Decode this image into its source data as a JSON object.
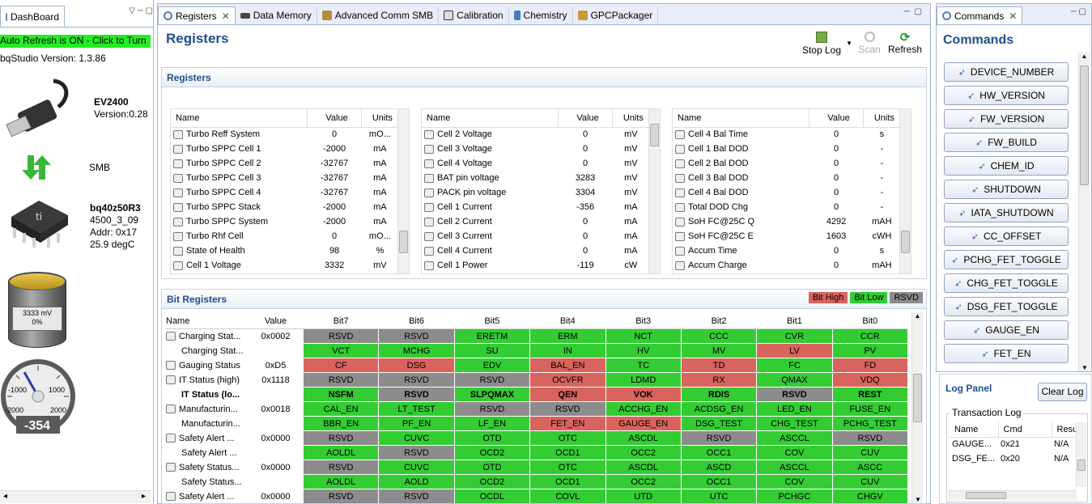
{
  "dashboard": {
    "tab_label": "DashBoard",
    "auto_refresh": "Auto Refresh is ON - Click to Turn",
    "version_line": "bqStudio Version:  1.3.86",
    "ev_name": "EV2400",
    "ev_version": "Version:0.28",
    "bus": "SMB",
    "device_name": "bq40z50R3",
    "device_fw": "4500_3_09",
    "device_addr": "Addr: 0x17",
    "device_temp": "25.9 degC",
    "battery_voltage": "3333 mV",
    "battery_pct": "0%",
    "gauge_value": "-354",
    "gauge_ticks": [
      "-1000",
      "1000",
      "-2000",
      "2000"
    ]
  },
  "tabs": [
    {
      "label": "Registers",
      "icon": "gear-icon"
    },
    {
      "label": "Data Memory",
      "icon": "memory-icon"
    },
    {
      "label": "Advanced Comm SMB",
      "icon": "package-icon"
    },
    {
      "label": "Calibration",
      "icon": "calibration-icon"
    },
    {
      "label": "Chemistry",
      "icon": "flask-icon"
    },
    {
      "label": "GPCPackager",
      "icon": "packager-icon"
    }
  ],
  "registers_page": {
    "title": "Registers",
    "stop_log": "Stop Log",
    "scan": "Scan",
    "refresh": "Refresh",
    "section": "Registers",
    "headers": [
      "Name",
      "Value",
      "Units"
    ],
    "table1": [
      [
        "Turbo Reff System",
        "0",
        "mO..."
      ],
      [
        "Turbo SPPC Cell 1",
        "-2000",
        "mA"
      ],
      [
        "Turbo SPPC Cell 2",
        "-32767",
        "mA"
      ],
      [
        "Turbo SPPC Cell 3",
        "-32767",
        "mA"
      ],
      [
        "Turbo SPPC Cell 4",
        "-32767",
        "mA"
      ],
      [
        "Turbo SPPC Stack",
        "-2000",
        "mA"
      ],
      [
        "Turbo SPPC System",
        "-2000",
        "mA"
      ],
      [
        "Turbo Rhf Cell",
        "0",
        "mO..."
      ],
      [
        "State of Health",
        "98",
        "%"
      ],
      [
        "Cell 1 Voltage",
        "3332",
        "mV"
      ]
    ],
    "table2": [
      [
        "Cell 2 Voltage",
        "0",
        "mV"
      ],
      [
        "Cell 3 Voltage",
        "0",
        "mV"
      ],
      [
        "Cell 4 Voltage",
        "0",
        "mV"
      ],
      [
        "BAT pin voltage",
        "3283",
        "mV"
      ],
      [
        "PACK pin voltage",
        "3304",
        "mV"
      ],
      [
        "Cell 1 Current",
        "-356",
        "mA"
      ],
      [
        "Cell 2 Current",
        "0",
        "mA"
      ],
      [
        "Cell 3 Current",
        "0",
        "mA"
      ],
      [
        "Cell 4 Current",
        "0",
        "mA"
      ],
      [
        "Cell 1 Power",
        "-119",
        "cW"
      ]
    ],
    "table3": [
      [
        "Cell 4 Bal Time",
        "0",
        "s"
      ],
      [
        "Cell 1 Bal DOD",
        "0",
        "-"
      ],
      [
        "Cell 2 Bal DOD",
        "0",
        "-"
      ],
      [
        "Cell 3 Bal DOD",
        "0",
        "-"
      ],
      [
        "Cell 4 Bal DOD",
        "0",
        "-"
      ],
      [
        "Total DOD Chg",
        "0",
        "-"
      ],
      [
        "SoH FC@25C Q",
        "4292",
        "mAH"
      ],
      [
        "SoH FC@25C E",
        "1603",
        "cWH"
      ],
      [
        "Accum Time",
        "0",
        "s"
      ],
      [
        "Accum Charge",
        "0",
        "mAH"
      ]
    ]
  },
  "bit_registers": {
    "title": "Bit Registers",
    "legend": [
      {
        "label": "Bit High",
        "color": "#d9635d"
      },
      {
        "label": "Bit Low",
        "color": "#33cc33"
      },
      {
        "label": "RSVD",
        "color": "#8c8c8c"
      }
    ],
    "headers": [
      "Name",
      "Value",
      "Bit7",
      "Bit6",
      "Bit5",
      "Bit4",
      "Bit3",
      "Bit2",
      "Bit1",
      "Bit0"
    ],
    "rows": [
      {
        "name": "Charging Stat...",
        "value": "0x0002",
        "lock": true,
        "bold": false,
        "bits": [
          [
            "RSVD",
            "gr"
          ],
          [
            "RSVD",
            "gr"
          ],
          [
            "ERETM",
            "g"
          ],
          [
            "ERM",
            "g"
          ],
          [
            "NCT",
            "g"
          ],
          [
            "CCC",
            "g"
          ],
          [
            "CVR",
            "g"
          ],
          [
            "CCR",
            "g"
          ]
        ]
      },
      {
        "name": "Charging Stat...",
        "value": "",
        "lock": false,
        "bold": false,
        "bits": [
          [
            "VCT",
            "g"
          ],
          [
            "MCHG",
            "g"
          ],
          [
            "SU",
            "g"
          ],
          [
            "IN",
            "g"
          ],
          [
            "HV",
            "g"
          ],
          [
            "MV",
            "g"
          ],
          [
            "LV",
            "r"
          ],
          [
            "PV",
            "g"
          ]
        ]
      },
      {
        "name": "Gauging Status",
        "value": "0xD5",
        "lock": true,
        "bold": false,
        "bits": [
          [
            "CF",
            "r"
          ],
          [
            "DSG",
            "r"
          ],
          [
            "EDV",
            "g"
          ],
          [
            "BAL_EN",
            "r"
          ],
          [
            "TC",
            "g"
          ],
          [
            "TD",
            "r"
          ],
          [
            "FC",
            "g"
          ],
          [
            "FD",
            "r"
          ]
        ]
      },
      {
        "name": "IT Status (high)",
        "value": "0x1118",
        "lock": true,
        "bold": false,
        "bits": [
          [
            "RSVD",
            "gr"
          ],
          [
            "RSVD",
            "gr"
          ],
          [
            "RSVD",
            "gr"
          ],
          [
            "OCVFR",
            "r"
          ],
          [
            "LDMD",
            "g"
          ],
          [
            "RX",
            "r"
          ],
          [
            "QMAX",
            "g"
          ],
          [
            "VDQ",
            "r"
          ]
        ]
      },
      {
        "name": "IT Status (lo...",
        "value": "",
        "lock": false,
        "bold": true,
        "bits": [
          [
            "NSFM",
            "g"
          ],
          [
            "RSVD",
            "gr"
          ],
          [
            "SLPQMAX",
            "g"
          ],
          [
            "QEN",
            "r"
          ],
          [
            "VOK",
            "r"
          ],
          [
            "RDIS",
            "g"
          ],
          [
            "RSVD",
            "gr"
          ],
          [
            "REST",
            "g"
          ]
        ]
      },
      {
        "name": "Manufacturin...",
        "value": "0x0018",
        "lock": true,
        "bold": false,
        "bits": [
          [
            "CAL_EN",
            "g"
          ],
          [
            "LT_TEST",
            "g"
          ],
          [
            "RSVD",
            "gr"
          ],
          [
            "RSVD",
            "gr"
          ],
          [
            "ACCHG_EN",
            "g"
          ],
          [
            "ACDSG_EN",
            "g"
          ],
          [
            "LED_EN",
            "g"
          ],
          [
            "FUSE_EN",
            "g"
          ]
        ]
      },
      {
        "name": "Manufacturin...",
        "value": "",
        "lock": false,
        "bold": false,
        "bits": [
          [
            "BBR_EN",
            "g"
          ],
          [
            "PF_EN",
            "g"
          ],
          [
            "LF_EN",
            "g"
          ],
          [
            "FET_EN",
            "r"
          ],
          [
            "GAUGE_EN",
            "r"
          ],
          [
            "DSG_TEST",
            "g"
          ],
          [
            "CHG_TEST",
            "g"
          ],
          [
            "PCHG_TEST",
            "g"
          ]
        ]
      },
      {
        "name": "Safety Alert ...",
        "value": "0x0000",
        "lock": true,
        "bold": false,
        "bits": [
          [
            "RSVD",
            "gr"
          ],
          [
            "CUVC",
            "g"
          ],
          [
            "OTD",
            "g"
          ],
          [
            "OTC",
            "g"
          ],
          [
            "ASCDL",
            "g"
          ],
          [
            "RSVD",
            "gr"
          ],
          [
            "ASCCL",
            "g"
          ],
          [
            "RSVD",
            "gr"
          ]
        ]
      },
      {
        "name": "Safety Alert ...",
        "value": "",
        "lock": false,
        "bold": false,
        "bits": [
          [
            "AOLDL",
            "g"
          ],
          [
            "RSVD",
            "gr"
          ],
          [
            "OCD2",
            "g"
          ],
          [
            "OCD1",
            "g"
          ],
          [
            "OCC2",
            "g"
          ],
          [
            "OCC1",
            "g"
          ],
          [
            "COV",
            "g"
          ],
          [
            "CUV",
            "g"
          ]
        ]
      },
      {
        "name": "Safety Status...",
        "value": "0x0000",
        "lock": true,
        "bold": false,
        "bits": [
          [
            "RSVD",
            "gr"
          ],
          [
            "CUVC",
            "g"
          ],
          [
            "OTD",
            "g"
          ],
          [
            "OTC",
            "g"
          ],
          [
            "ASCDL",
            "g"
          ],
          [
            "ASCD",
            "g"
          ],
          [
            "ASCCL",
            "g"
          ],
          [
            "ASCC",
            "g"
          ]
        ]
      },
      {
        "name": "Safety Status...",
        "value": "",
        "lock": false,
        "bold": false,
        "bits": [
          [
            "AOLDL",
            "g"
          ],
          [
            "AOLD",
            "g"
          ],
          [
            "OCD2",
            "g"
          ],
          [
            "OCD1",
            "g"
          ],
          [
            "OCC2",
            "g"
          ],
          [
            "OCC1",
            "g"
          ],
          [
            "COV",
            "g"
          ],
          [
            "CUV",
            "g"
          ]
        ]
      },
      {
        "name": "Safety Alert ...",
        "value": "0x0000",
        "lock": true,
        "bold": false,
        "bits": [
          [
            "RSVD",
            "gr"
          ],
          [
            "RSVD",
            "gr"
          ],
          [
            "OCDL",
            "g"
          ],
          [
            "COVL",
            "g"
          ],
          [
            "UTD",
            "g"
          ],
          [
            "UTC",
            "g"
          ],
          [
            "PCHGC",
            "g"
          ],
          [
            "CHGV",
            "g"
          ]
        ]
      }
    ]
  },
  "commands": {
    "tab_label": "Commands",
    "title": "Commands",
    "buttons": [
      "DEVICE_NUMBER",
      "HW_VERSION",
      "FW_VERSION",
      "FW_BUILD",
      "CHEM_ID",
      "SHUTDOWN",
      "IATA_SHUTDOWN",
      "CC_OFFSET",
      "PCHG_FET_TOGGLE",
      "CHG_FET_TOGGLE",
      "DSG_FET_TOGGLE",
      "GAUGE_EN",
      "FET_EN"
    ]
  },
  "log_panel": {
    "title": "Log Panel",
    "clear": "Clear Log",
    "group": "Transaction Log",
    "headers": [
      "Name",
      "Cmd",
      "Resu"
    ],
    "rows": [
      [
        "GAUGE...",
        "0x21",
        "N/A"
      ],
      [
        "DSG_FE...",
        "0x20",
        "N/A"
      ]
    ]
  }
}
